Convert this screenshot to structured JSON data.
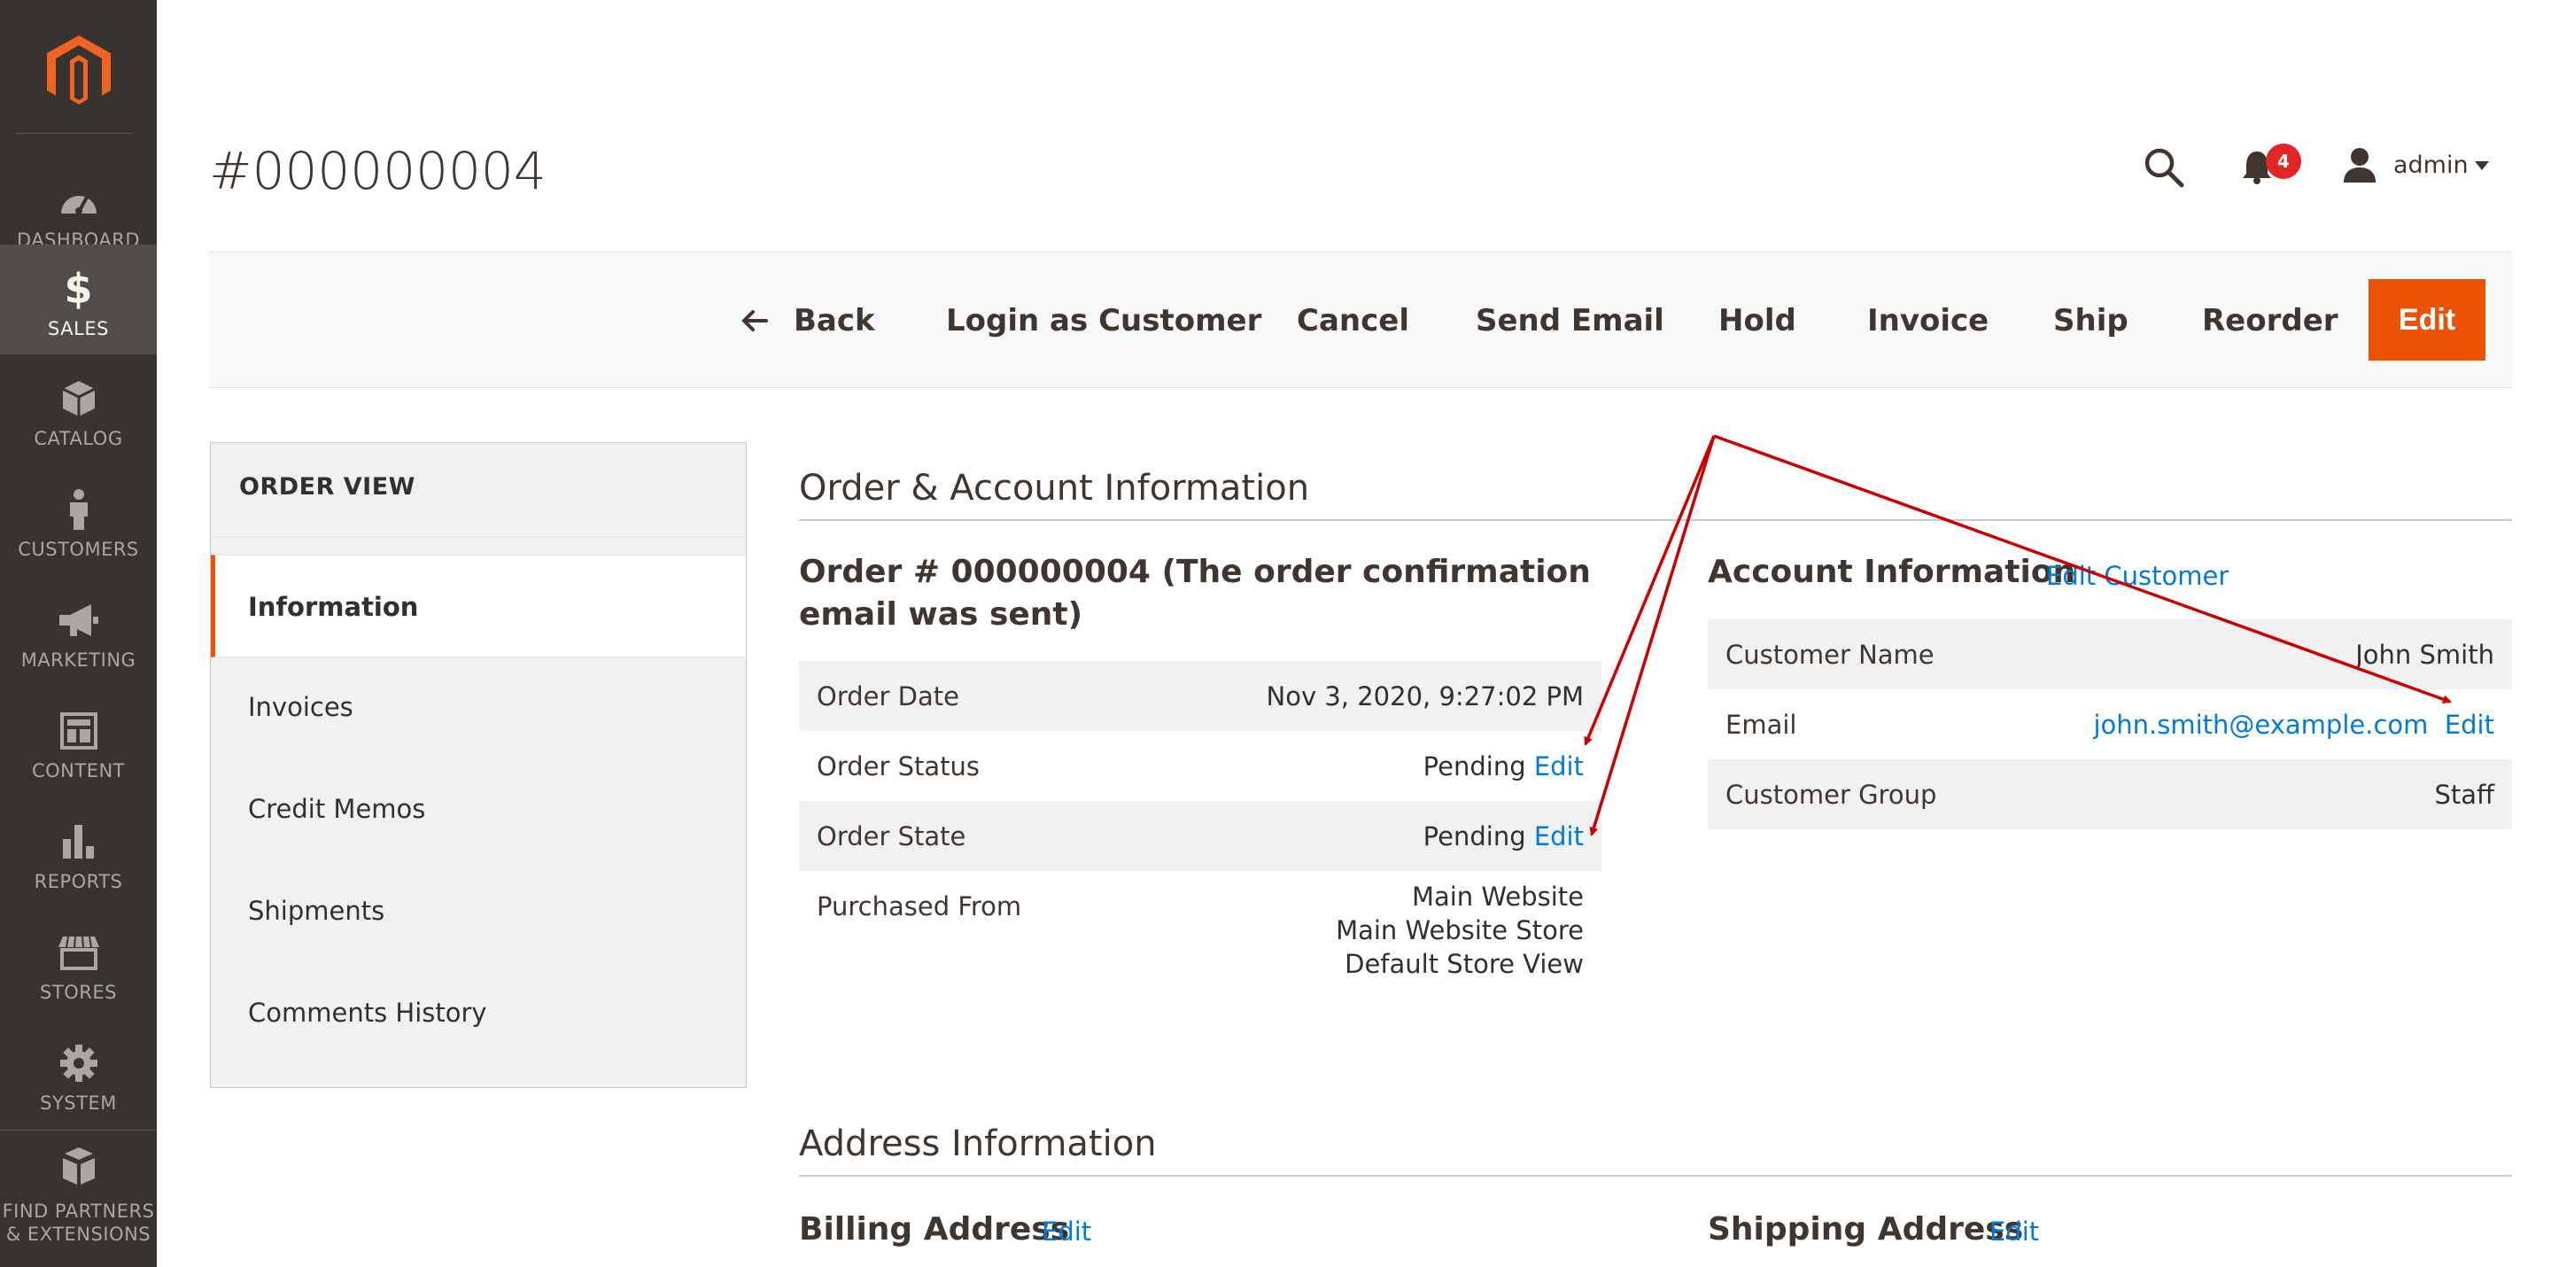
{
  "sidebar": {
    "items": [
      {
        "label": "DASHBOARD",
        "icon": "dashboard-icon"
      },
      {
        "label": "SALES",
        "icon": "dollar-icon",
        "active": true
      },
      {
        "label": "CATALOG",
        "icon": "cube-icon"
      },
      {
        "label": "CUSTOMERS",
        "icon": "person-icon"
      },
      {
        "label": "MARKETING",
        "icon": "megaphone-icon"
      },
      {
        "label": "CONTENT",
        "icon": "layout-icon"
      },
      {
        "label": "REPORTS",
        "icon": "bar-chart-icon"
      },
      {
        "label": "STORES",
        "icon": "storefront-icon"
      },
      {
        "label": "SYSTEM",
        "icon": "gear-icon"
      },
      {
        "label_line1": "FIND PARTNERS",
        "label_line2": "& EXTENSIONS",
        "icon": "boxes-icon"
      }
    ]
  },
  "header": {
    "title": "#000000004",
    "notification_count": "4",
    "user": "admin"
  },
  "actions": {
    "back": "Back",
    "login_as_customer": "Login as Customer",
    "cancel": "Cancel",
    "send_email": "Send Email",
    "hold": "Hold",
    "invoice": "Invoice",
    "ship": "Ship",
    "reorder": "Reorder",
    "edit": "Edit"
  },
  "tabs": {
    "title": "ORDER VIEW",
    "items": [
      "Information",
      "Invoices",
      "Credit Memos",
      "Shipments",
      "Comments History"
    ]
  },
  "order_account": {
    "section_title": "Order & Account Information",
    "order_title": "Order # 000000004 (The order confirmation email was sent)",
    "order_rows": {
      "order_date": {
        "label": "Order Date",
        "value": "Nov 3, 2020, 9:27:02 PM"
      },
      "order_status": {
        "label": "Order Status",
        "value": "Pending",
        "link": "Edit"
      },
      "order_state": {
        "label": "Order State",
        "value": "Pending",
        "link": "Edit"
      },
      "purchased_from": {
        "label": "Purchased From",
        "line1": "Main Website",
        "line2": "Main Website Store",
        "line3": "Default Store View"
      }
    },
    "account_title": "Account Information",
    "account_link": "Edit Customer",
    "account_rows": {
      "customer_name": {
        "label": "Customer Name",
        "value": "John Smith"
      },
      "email": {
        "label": "Email",
        "value": "john.smith@example.com",
        "link": "Edit"
      },
      "customer_group": {
        "label": "Customer Group",
        "value": "Staff"
      }
    }
  },
  "address": {
    "section_title": "Address Information",
    "billing_title": "Billing Address",
    "billing_link": "Edit",
    "shipping_title": "Shipping Address",
    "shipping_link": "Edit"
  },
  "colors": {
    "sidebar_bg": "#373330",
    "sidebar_active": "#524d49",
    "accent": "#eb5202",
    "link": "#007bdb",
    "annotation_arrow": "#cc0000"
  }
}
